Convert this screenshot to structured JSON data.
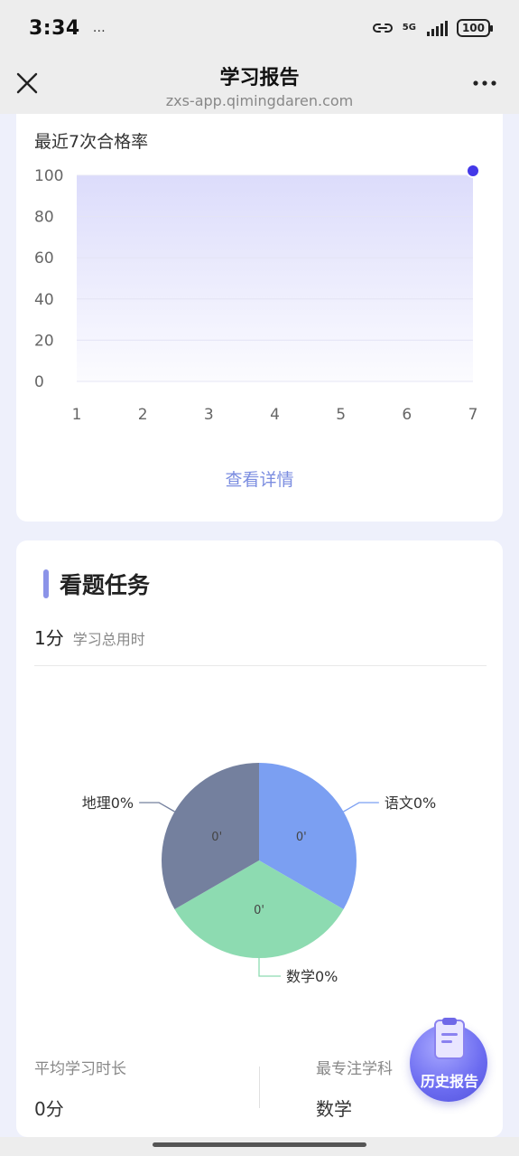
{
  "status": {
    "time": "3:34",
    "extra": "…",
    "network": "5G",
    "battery": "100"
  },
  "nav": {
    "title": "学习报告",
    "url": "zxs-app.qimingdaren.com"
  },
  "chart_card": {
    "title": "最近7次合格率",
    "detail_link": "查看详情"
  },
  "chart_data": {
    "type": "area",
    "title": "最近7次合格率",
    "x": [
      1,
      2,
      3,
      4,
      5,
      6,
      7
    ],
    "y_ticks": [
      100,
      80,
      60,
      40,
      20,
      0
    ],
    "ylim": [
      0,
      100
    ],
    "series": [
      {
        "values": [
          null,
          null,
          null,
          null,
          null,
          null,
          100
        ]
      }
    ],
    "grid": true,
    "area_color": "#dcdcfb",
    "point_color": "#4338e8"
  },
  "task_card": {
    "title": "看题任务",
    "time_value": "1分",
    "time_label": "学习总用时"
  },
  "pie_data": {
    "type": "pie",
    "slices": [
      {
        "name": "语文0%",
        "inner_label": "0'",
        "value": 1,
        "color": "#7b9ff2"
      },
      {
        "name": "数学0%",
        "inner_label": "0'",
        "value": 1,
        "color": "#8ddbb1"
      },
      {
        "name": "地理0%",
        "inner_label": "0'",
        "value": 1,
        "color": "#74809e"
      }
    ]
  },
  "stats": {
    "avg_label": "平均学习时长",
    "avg_value": "0分",
    "focus_label": "最专注学科",
    "focus_value": "数学"
  },
  "history_button": {
    "label": "历史报告"
  }
}
